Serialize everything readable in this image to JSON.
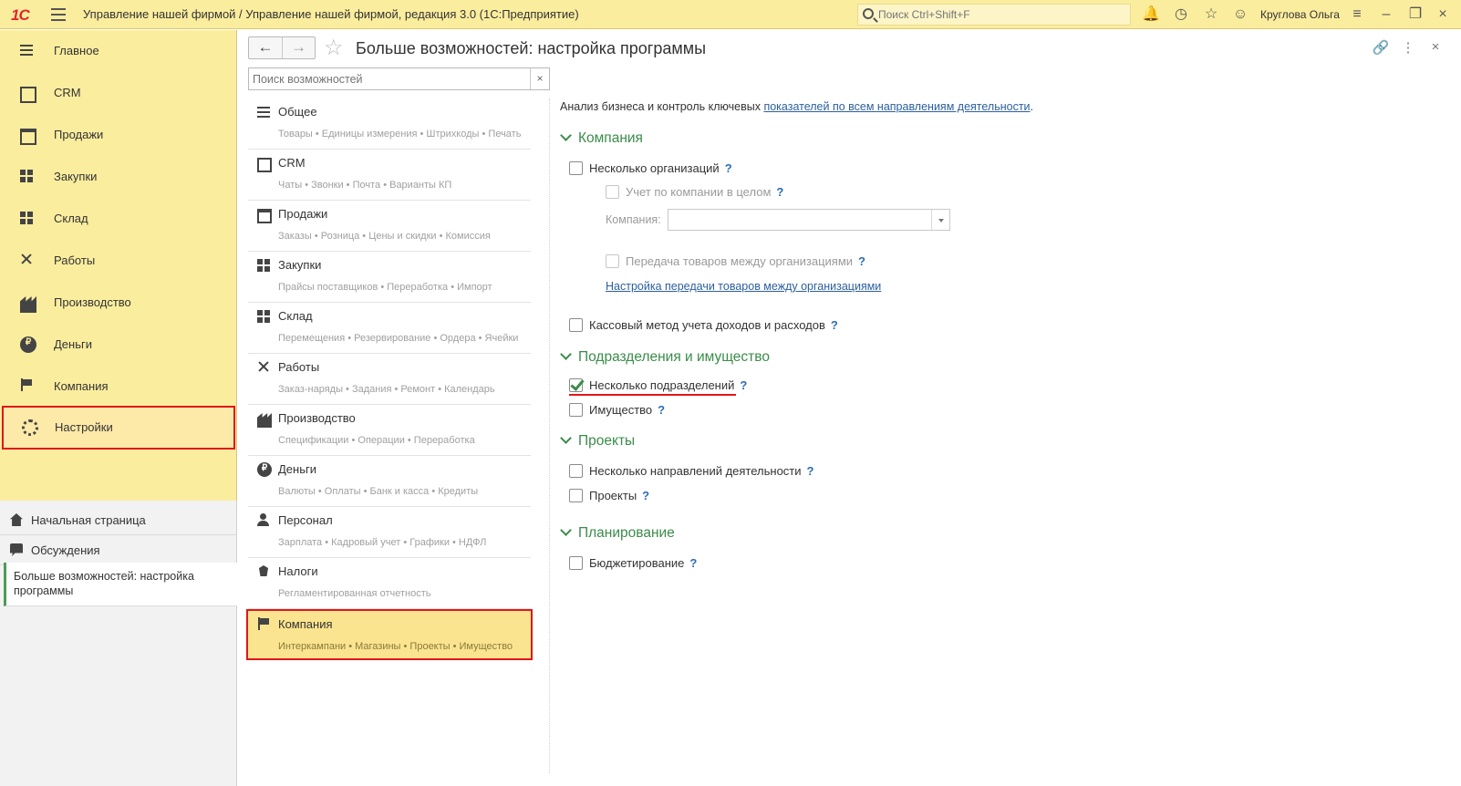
{
  "app": {
    "logo_text": "1С",
    "title": "Управление нашей фирмой / Управление нашей фирмой, редакция 3.0  (1С:Предприятие)",
    "search_placeholder": "Поиск Ctrl+Shift+F",
    "user": "Круглова Ольга"
  },
  "sections": [
    {
      "label": "Главное",
      "icon": "list-icon"
    },
    {
      "label": "CRM",
      "icon": "crm-icon"
    },
    {
      "label": "Продажи",
      "icon": "basket-icon"
    },
    {
      "label": "Закупки",
      "icon": "cart-icon"
    },
    {
      "label": "Склад",
      "icon": "warehouse-icon"
    },
    {
      "label": "Работы",
      "icon": "tools-icon"
    },
    {
      "label": "Производство",
      "icon": "factory-icon"
    },
    {
      "label": "Деньги",
      "icon": "ruble-icon"
    },
    {
      "label": "Компания",
      "icon": "flag-icon"
    },
    {
      "label": "Настройки",
      "icon": "gear-icon"
    }
  ],
  "nav": {
    "home": "Начальная страница",
    "discussions": "Обсуждения",
    "open_form": "Больше возможностей: настройка программы"
  },
  "form": {
    "title": "Больше возможностей: настройка программы",
    "back": "←",
    "forward": "→",
    "search_placeholder": "Поиск возможностей",
    "clear": "×"
  },
  "features": [
    {
      "title": "Общее",
      "sub": "Товары • Единицы измерения • Штрихкоды • Печать"
    },
    {
      "title": "CRM",
      "sub": "Чаты • Звонки • Почта • Варианты КП"
    },
    {
      "title": "Продажи",
      "sub": "Заказы • Розница • Цены и скидки • Комиссия"
    },
    {
      "title": "Закупки",
      "sub": "Прайсы поставщиков • Переработка • Импорт"
    },
    {
      "title": "Склад",
      "sub": "Перемещения • Резервирование • Ордера • Ячейки"
    },
    {
      "title": "Работы",
      "sub": "Заказ-наряды • Задания • Ремонт • Календарь"
    },
    {
      "title": "Производство",
      "sub": "Спецификации • Операции • Переработка"
    },
    {
      "title": "Деньги",
      "sub": "Валюты • Оплаты • Банк и касса • Кредиты"
    },
    {
      "title": "Персонал",
      "sub": "Зарплата • Кадровый учет • Графики • НДФЛ"
    },
    {
      "title": "Налоги",
      "sub": "Регламентированная отчетность"
    },
    {
      "title": "Компания",
      "sub": "Интеркампани • Магазины • Проекты • Имущество"
    }
  ],
  "settings": {
    "intro_text": "Анализ бизнеса и контроль ключевых ",
    "intro_link": "показателей по всем направлениям деятельности",
    "intro_end": ".",
    "group_company": "Компания",
    "opt_multi_org": "Несколько организаций",
    "opt_company_whole": "Учет по компании в целом",
    "company_label": "Компания:",
    "company_value": "",
    "opt_transfer": "Передача товаров между организациями",
    "link_transfer": "Настройка передачи товаров между организациями",
    "opt_cash_method": "Кассовый метод учета доходов и расходов",
    "group_divisions": "Подразделения и имущество",
    "opt_multi_div": "Несколько подразделений",
    "opt_property": "Имущество",
    "group_projects": "Проекты",
    "opt_multi_dir": "Несколько направлений деятельности",
    "opt_projects": "Проекты",
    "group_planning": "Планирование",
    "opt_budgeting": "Бюджетирование",
    "help": "?"
  }
}
